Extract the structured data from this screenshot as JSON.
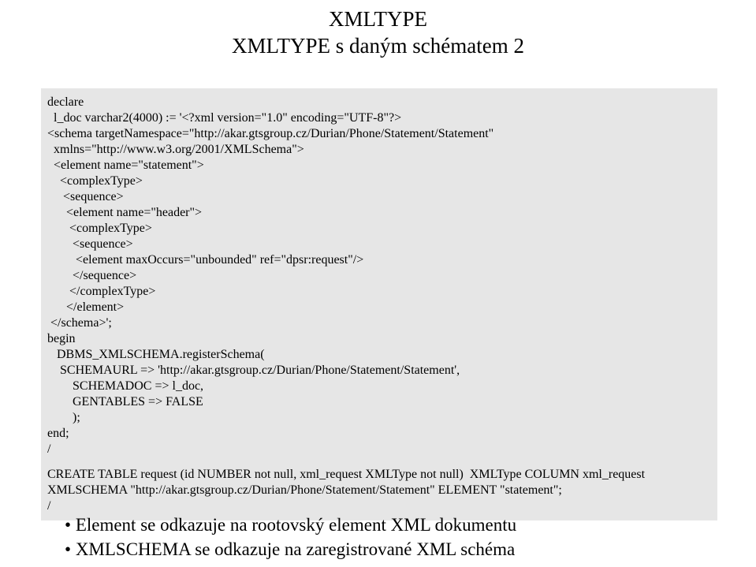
{
  "title": {
    "line1": "XMLTYPE",
    "line2": "XMLTYPE s daným schématem  2"
  },
  "code": "declare\n  l_doc varchar2(4000) := '<?xml version=\"1.0\" encoding=\"UTF-8\"?>\n<schema targetNamespace=\"http://akar.gtsgroup.cz/Durian/Phone/Statement/Statement\"\n  xmlns=\"http://www.w3.org/2001/XMLSchema\">\n  <element name=\"statement\">\n    <complexType>\n     <sequence>\n      <element name=\"header\">\n       <complexType>\n        <sequence>\n         <element maxOccurs=\"unbounded\" ref=\"dpsr:request\"/>\n        </sequence>\n       </complexType>\n      </element>\n </schema>';\nbegin\n   DBMS_XMLSCHEMA.registerSchema(\n    SCHEMAURL => 'http://akar.gtsgroup.cz/Durian/Phone/Statement/Statement',\n        SCHEMADOC => l_doc,\n        GENTABLES => FALSE\n        );\nend;\n/",
  "create_stmt": "CREATE TABLE request (id NUMBER not null, xml_request XMLType not null)  XMLType COLUMN xml_request XMLSCHEMA \"http://akar.gtsgroup.cz/Durian/Phone/Statement/Statement\" ELEMENT \"statement\";\n/",
  "bullets": {
    "b1": "Element se odkazuje na rootovský element XML dokumentu",
    "b2": "XMLSCHEMA se odkazuje na zaregistrované XML schéma"
  }
}
